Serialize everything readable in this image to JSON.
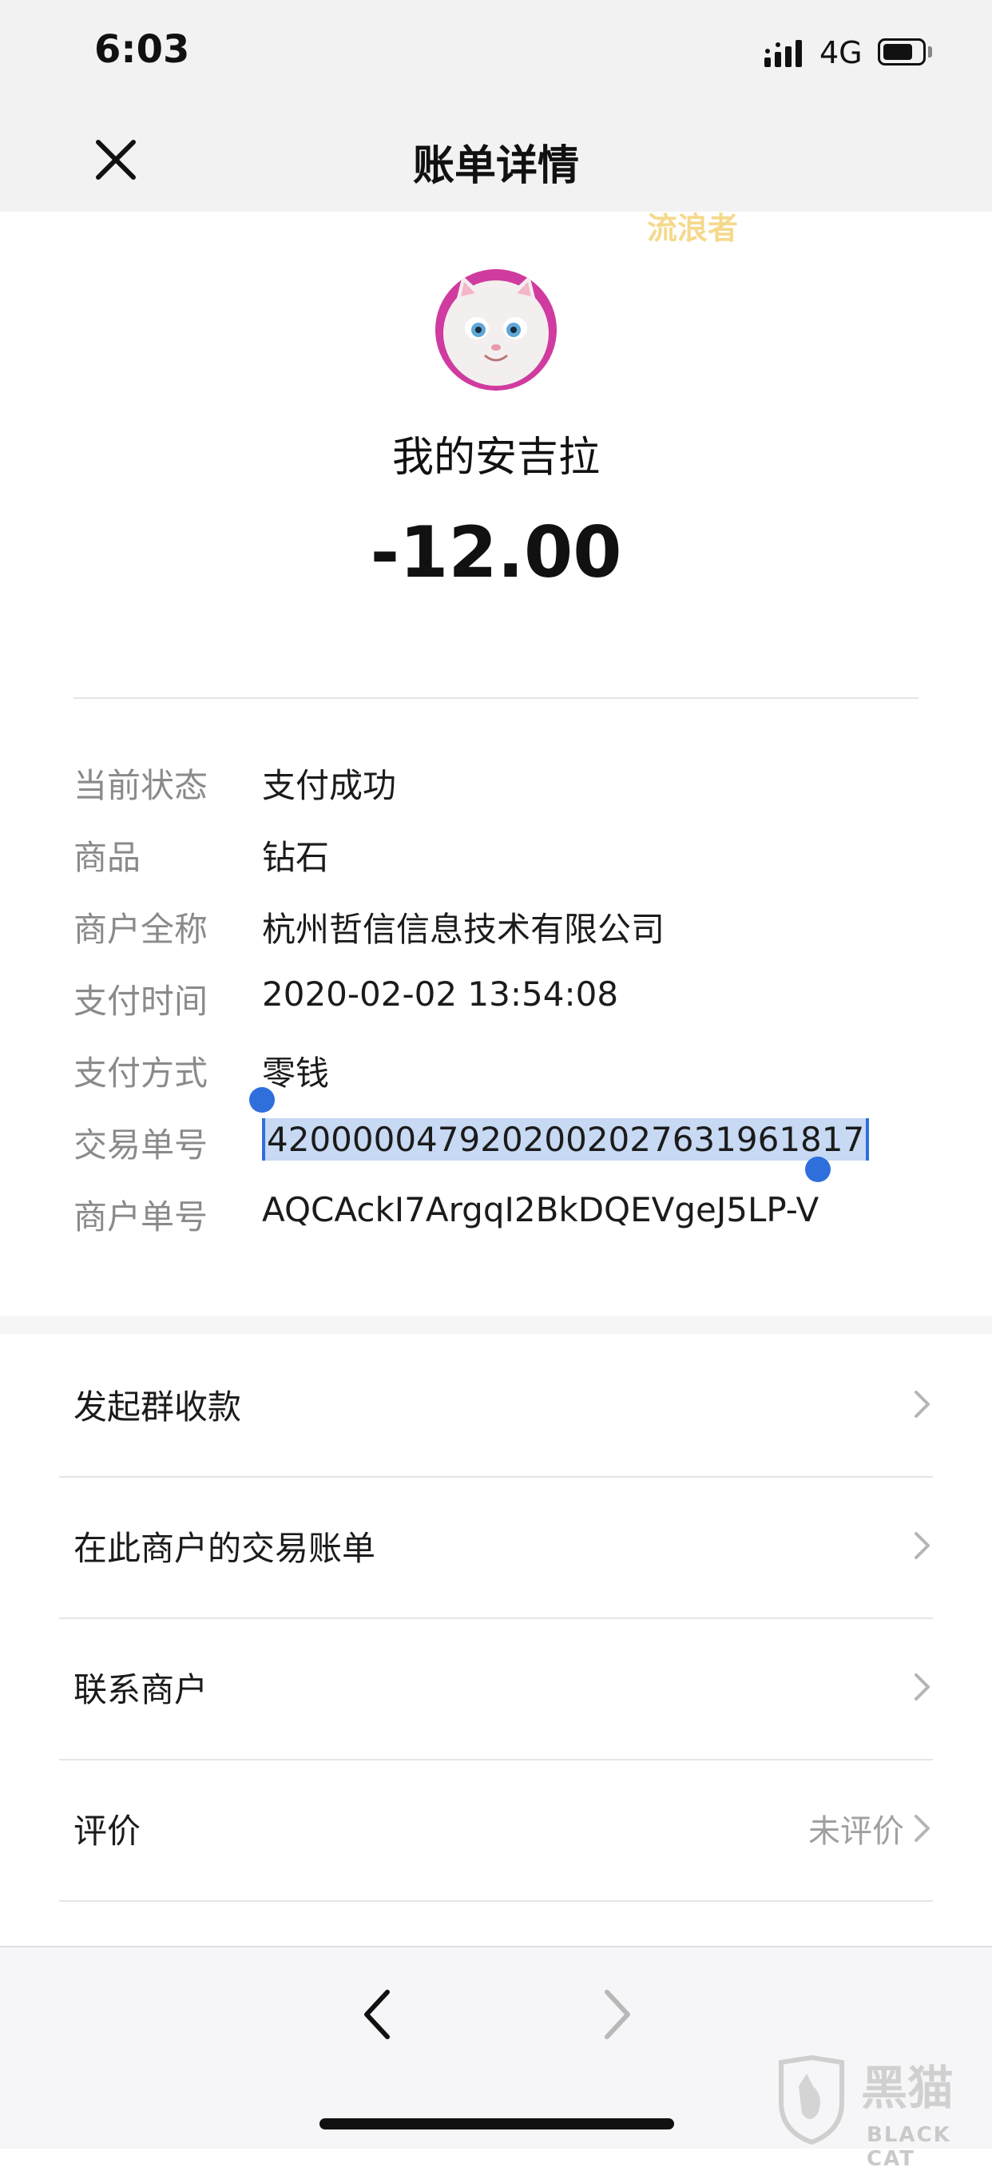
{
  "status_bar": {
    "time": "6:03",
    "network": "4G"
  },
  "nav": {
    "title": "账单详情"
  },
  "watermark": {
    "text": "流浪者",
    "brand_en": "BLACK CAT",
    "brand_cn": "黑猫"
  },
  "merchant": {
    "name": "我的安吉拉",
    "amount": "-12.00"
  },
  "details": [
    {
      "label": "当前状态",
      "value": "支付成功"
    },
    {
      "label": "商品",
      "value": "钻石"
    },
    {
      "label": "商户全称",
      "value": "杭州哲信信息技术有限公司"
    },
    {
      "label": "支付时间",
      "value": "2020-02-02 13:54:08"
    },
    {
      "label": "支付方式",
      "value": "零钱"
    },
    {
      "label": "交易单号",
      "value": "4200000479202002027631961817"
    },
    {
      "label": "商户单号",
      "value": "AQCAckI7ArgqI2BkDQEVgeJ5LP-V"
    }
  ],
  "menu": [
    {
      "label": "发起群收款",
      "extra": ""
    },
    {
      "label": "在此商户的交易账单",
      "extra": ""
    },
    {
      "label": "联系商户",
      "extra": ""
    },
    {
      "label": "评价",
      "extra": "未评价"
    }
  ],
  "colors": {
    "selection": "#c7d9f3",
    "selection_handle": "#2f6fdc",
    "label_gray": "#8a8a8a",
    "avatar_ring": "#d03ba0"
  }
}
